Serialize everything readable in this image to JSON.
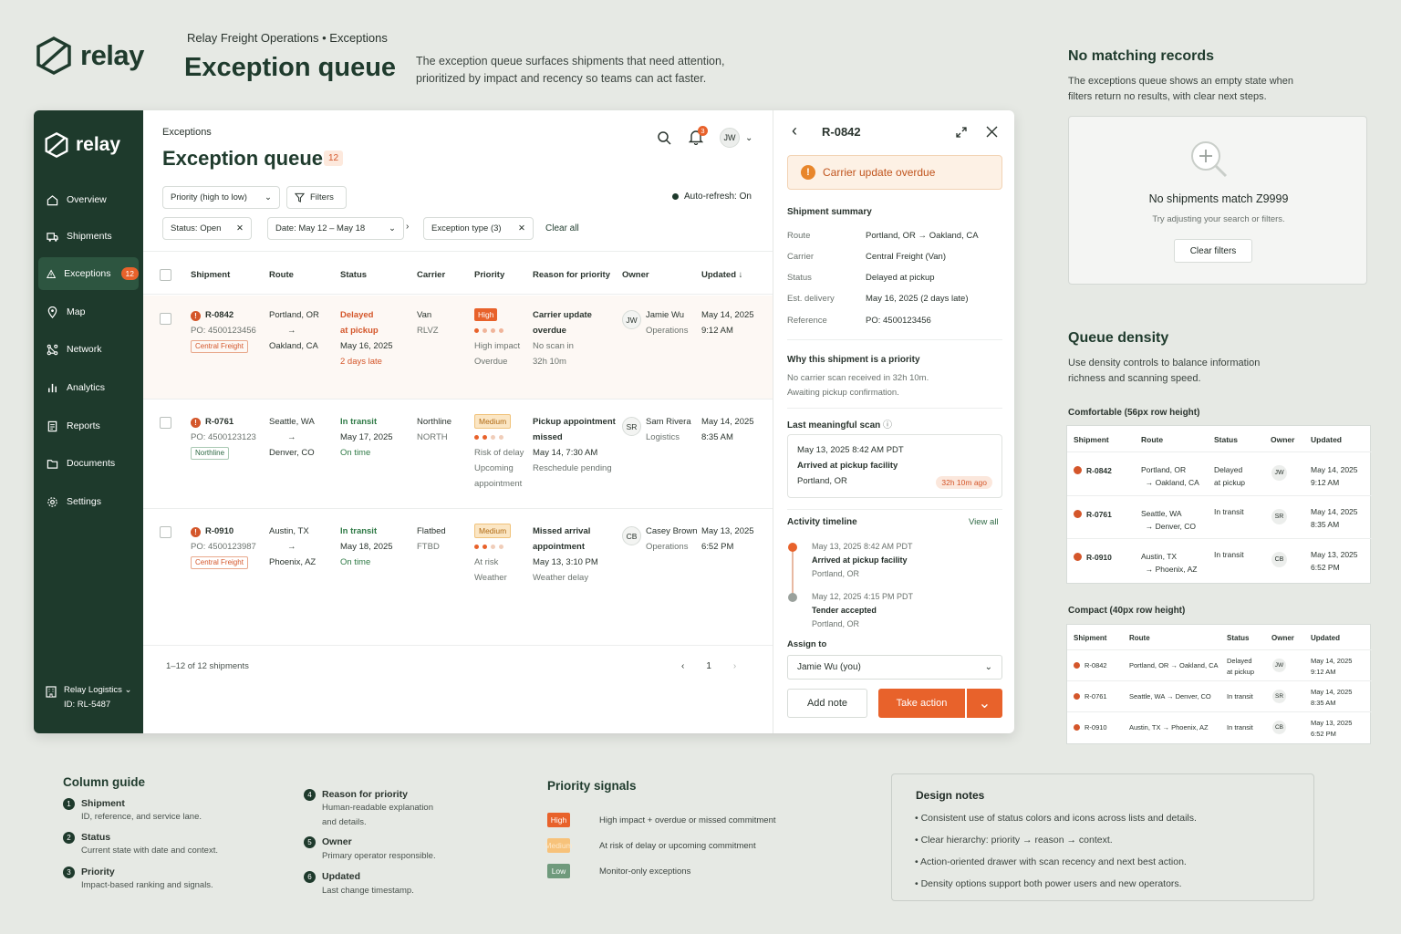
{
  "brand": {
    "name": "relay"
  },
  "header": {
    "breadcrumb": "Relay Freight Operations  •  Exceptions",
    "title": "Exception queue",
    "intro": "The exception queue surfaces shipments that need attention, prioritized by impact and recency so teams can act faster."
  },
  "sidebar": {
    "items": [
      {
        "label": "Overview",
        "icon": "home-icon"
      },
      {
        "label": "Shipments",
        "icon": "truck-icon"
      },
      {
        "label": "Exceptions",
        "icon": "warning-icon",
        "count": "12"
      },
      {
        "label": "Map",
        "icon": "map-pin-icon"
      },
      {
        "label": "Network",
        "icon": "network-icon"
      },
      {
        "label": "Analytics",
        "icon": "bar-chart-icon"
      },
      {
        "label": "Reports",
        "icon": "report-icon"
      },
      {
        "label": "Documents",
        "icon": "folder-icon"
      },
      {
        "label": "Settings",
        "icon": "gear-icon"
      }
    ],
    "org": "Relay Logistics",
    "org_id": "ID: RL-5487"
  },
  "queue": {
    "section": "Exceptions",
    "title": "Exception queue",
    "count": "12",
    "notifications": "3",
    "user_initials": "JW",
    "sort": "Priority (high to low)",
    "filters": "Filters",
    "autorefresh": "Auto-refresh: On",
    "chips": {
      "status": "Status: Open",
      "date": "Date: May 12 – May 18",
      "type": "Exception type (3)"
    },
    "clear_all": "Clear all",
    "columns": [
      "Shipment",
      "Route",
      "Status",
      "Carrier",
      "Priority",
      "Reason for priority",
      "Owner",
      "Updated"
    ],
    "rows": [
      {
        "id": "R-0842",
        "po": "PO: 4500123456",
        "tag": "Central Freight",
        "from": "Portland, OR",
        "to": "Oakland, CA",
        "status1": "Delayed",
        "status2": "at pickup",
        "date": "May 16, 2025",
        "sub": "2 days late",
        "carrier": "Van",
        "carrier_code": "RLVZ",
        "priority": "High",
        "signal1": "High impact",
        "signal2": "Overdue",
        "reason1": "Carrier update",
        "reason2": "overdue",
        "reason3": "No scan in",
        "reason4": "32h 10m",
        "owner_initials": "JW",
        "owner": "Jamie Wu",
        "team": "Operations",
        "updated1": "May 14, 2025",
        "updated2": "9:12 AM"
      },
      {
        "id": "R-0761",
        "po": "PO: 4500123123",
        "tag": "Northline",
        "from": "Seattle, WA",
        "to": "Denver, CO",
        "status1": "In transit",
        "date": "May 17, 2025",
        "sub": "On time",
        "carrier": "Northline",
        "carrier_code": "NORTH",
        "priority": "Medium",
        "signal1": "Risk of delay",
        "signal2": "Upcoming",
        "signal3": "appointment",
        "reason1": "Pickup appointment",
        "reason2": "missed",
        "reason3": "May 14, 7:30 AM",
        "reason4": "Reschedule pending",
        "owner_initials": "SR",
        "owner": "Sam Rivera",
        "team": "Logistics",
        "updated1": "May 14, 2025",
        "updated2": "8:35 AM"
      },
      {
        "id": "R-0910",
        "po": "PO: 4500123987",
        "tag": "Central Freight",
        "from": "Austin, TX",
        "to": "Phoenix, AZ",
        "status1": "In transit",
        "date": "May 18, 2025",
        "sub": "On time",
        "carrier": "Flatbed",
        "carrier_code": "FTBD",
        "priority": "Medium",
        "signal1": "At risk",
        "signal2": "Weather",
        "reason1": "Missed arrival",
        "reason2": "appointment",
        "reason3": "May 13, 3:10 PM",
        "reason4": "Weather delay",
        "owner_initials": "CB",
        "owner": "Casey Brown",
        "team": "Operations",
        "updated1": "May 13, 2025",
        "updated2": "6:52 PM"
      }
    ],
    "footer": "1–12 of 12 shipments",
    "page": "1"
  },
  "drawer": {
    "id": "R-0842",
    "alert": "Carrier update overdue",
    "summary_title": "Shipment summary",
    "summary": [
      {
        "k": "Route",
        "v": "Portland, OR  →  Oakland, CA"
      },
      {
        "k": "Carrier",
        "v": "Central Freight (Van)"
      },
      {
        "k": "Status",
        "v": "Delayed at pickup"
      },
      {
        "k": "Est. delivery",
        "v": "May 16, 2025",
        "v2": "(2 days late)"
      },
      {
        "k": "Reference",
        "v": "PO: 4500123456"
      }
    ],
    "why_title": "Why this shipment is a priority",
    "why1": "No carrier scan received in 32h 10m.",
    "why2": "Awaiting pickup confirmation.",
    "scan_title": "Last meaningful scan",
    "scan": {
      "time": "May 13, 2025  8:42 AM PDT",
      "event": "Arrived at pickup facility",
      "place": "Portland, OR",
      "ago": "32h 10m ago"
    },
    "timeline_title": "Activity timeline",
    "view_all": "View all",
    "timeline": [
      {
        "time": "May 13, 2025   8:42 AM PDT",
        "event": "Arrived at pickup facility",
        "place": "Portland, OR"
      },
      {
        "time": "May 12, 2025   4:15 PM PDT",
        "event": "Tender accepted",
        "place": "Portland, OR"
      }
    ],
    "assign_label": "Assign to",
    "assignee": "Jamie Wu (you)",
    "add_note": "Add note",
    "take_action": "Take action"
  },
  "empty": {
    "title": "No matching records",
    "desc": "The exceptions queue shows an empty state when filters return no results, with clear next steps.",
    "card_title": "No shipments match Z9999",
    "card_sub": "Try adjusting your search or filters.",
    "button": "Clear filters"
  },
  "density": {
    "title": "Queue density",
    "desc": "Use density controls to balance information richness and scanning speed.",
    "comfortable_label": "Comfortable (56px row height)",
    "compact_label": "Compact (40px row height)",
    "columns": [
      "Shipment",
      "Route",
      "Status",
      "Owner",
      "Updated"
    ],
    "rows": [
      {
        "id": "R-0842",
        "from": "Portland, OR",
        "to": "Oakland, CA",
        "s1": "Delayed",
        "s2": "at pickup",
        "o": "JW",
        "u1": "May 14, 2025",
        "u2": "9:12 AM"
      },
      {
        "id": "R-0761",
        "from": "Seattle, WA",
        "to": "Denver, CO",
        "s1": "In transit",
        "s2": "",
        "o": "SR",
        "u1": "May 14, 2025",
        "u2": "8:35 AM"
      },
      {
        "id": "R-0910",
        "from": "Austin, TX",
        "to": "Phoenix, AZ",
        "s1": "In transit",
        "s2": "",
        "o": "CB",
        "u1": "May 13, 2025",
        "u2": "6:52 PM"
      }
    ],
    "compact_routes": [
      "Portland, OR → Oakland, CA",
      "Seattle, WA → Denver, CO",
      "Austin, TX → Phoenix, AZ"
    ]
  },
  "guide": {
    "title": "Column guide",
    "items": [
      {
        "n": "1",
        "t": "Shipment",
        "d": "ID, reference, and service lane."
      },
      {
        "n": "2",
        "t": "Status",
        "d": "Current state with date and context."
      },
      {
        "n": "3",
        "t": "Priority",
        "d": "Impact-based ranking and signals."
      },
      {
        "n": "4",
        "t": "Reason for priority",
        "d": "Human-readable explanation",
        "d2": "and details."
      },
      {
        "n": "5",
        "t": "Owner",
        "d": "Primary operator responsible."
      },
      {
        "n": "6",
        "t": "Updated",
        "d": "Last change timestamp."
      }
    ]
  },
  "signals": {
    "title": "Priority signals",
    "items": [
      {
        "badge": "High",
        "text": "High impact + overdue or missed commitment",
        "bg": "#e8622b",
        "fg": "#ffffff"
      },
      {
        "badge": "Medium",
        "text": "At risk of delay or upcoming commitment",
        "bg": "#f7c27a",
        "fg": "#fde8c8"
      },
      {
        "badge": "Low",
        "text": "Monitor-only exceptions",
        "bg": "#6f9a7c",
        "fg": "#ffffff"
      }
    ]
  },
  "notes": {
    "title": "Design notes",
    "items": [
      "• Consistent use of status colors and icons across lists and details.",
      "• Clear hierarchy: priority → reason → context.",
      "• Action-oriented drawer with scan recency and next best action.",
      "• Density options support both power users and new operators."
    ]
  },
  "colors": {
    "brand_dark": "#1e3a2c",
    "accent": "#e8622b",
    "danger": "#d4562a",
    "ok": "#2f7a46"
  }
}
